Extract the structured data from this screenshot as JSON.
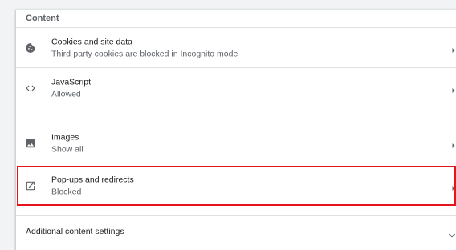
{
  "section": {
    "title": "Content"
  },
  "rows": [
    {
      "title": "Cookies and site data",
      "subtitle": "Third-party cookies are blocked in Incognito mode",
      "icon": "cookie-icon"
    },
    {
      "title": "JavaScript",
      "subtitle": "Allowed",
      "icon": "code-icon"
    },
    {
      "title": "Images",
      "subtitle": "Show all",
      "icon": "image-icon"
    },
    {
      "title": "Pop-ups and redirects",
      "subtitle": "Blocked",
      "icon": "open-in-new-icon"
    }
  ],
  "additional": {
    "label": "Additional content settings",
    "icon": "chevron-down-icon"
  },
  "colors": {
    "highlight": "#e8131d",
    "icon": "#5f6368"
  }
}
